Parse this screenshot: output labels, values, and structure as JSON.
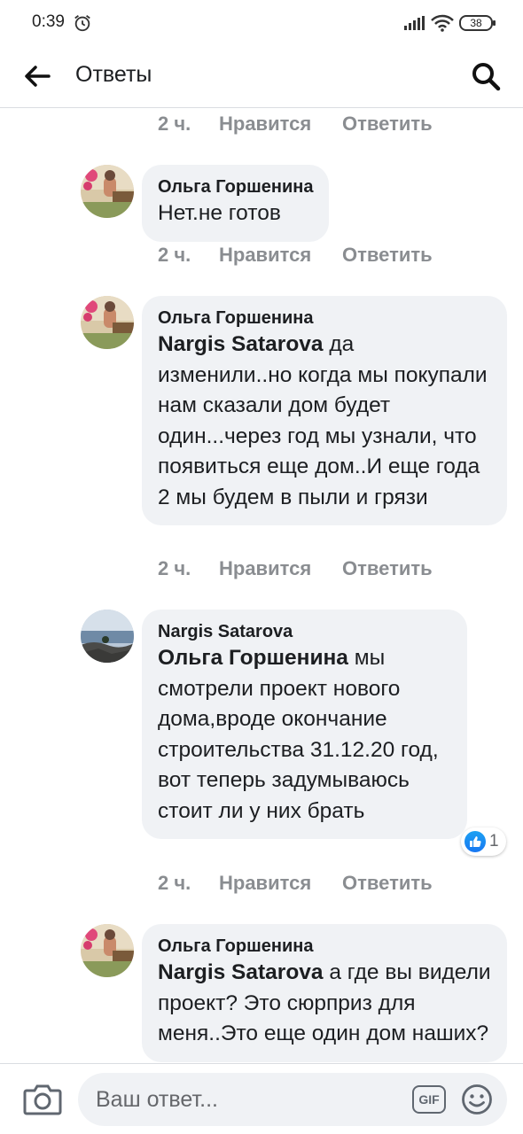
{
  "status_bar": {
    "time": "0:39",
    "battery": "38"
  },
  "header": {
    "title": "Ответы"
  },
  "comments": [
    {
      "time": "2 ч.",
      "like": "Нравится",
      "reply": "Ответить"
    },
    {
      "author": "Ольга Горшенина",
      "mention": "",
      "text": "Нет.не готов",
      "time": "2 ч.",
      "like": "Нравится",
      "reply": "Ответить"
    },
    {
      "author": "Ольга Горшенина",
      "mention": "Nargis Satarova",
      "text": " да изменили..но когда мы покупали нам сказали дом будет один...через год мы узнали, что  появиться еще дом..И еще года 2 мы будем в пыли и грязи",
      "time": "2 ч.",
      "like": "Нравится",
      "reply": "Ответить"
    },
    {
      "author": "Nargis Satarova",
      "mention": "Ольга Горшенина",
      "text": "  мы смотрели проект нового дома,вроде окончание строительства 31.12.20 год, вот теперь задумываюсь стоит ли у них брать",
      "time": "2 ч.",
      "like": "Нравится",
      "reply": "Ответить",
      "reactions": "1"
    },
    {
      "author": "Ольга Горшенина",
      "mention": "Nargis Satarova",
      "text": " а где вы видели проект? Это сюрприз для меня..Это еще один дом наших?"
    }
  ],
  "composer": {
    "placeholder": "Ваш ответ..."
  },
  "colors": {
    "bubble": "#f0f2f5",
    "meta": "#8a8d91",
    "like_blue": "#1877f2"
  },
  "icons": [
    "alarm-icon",
    "signal-icon",
    "wifi-icon",
    "back-arrow-icon",
    "search-icon",
    "like-icon",
    "camera-icon",
    "gif-icon",
    "emoji-icon"
  ]
}
